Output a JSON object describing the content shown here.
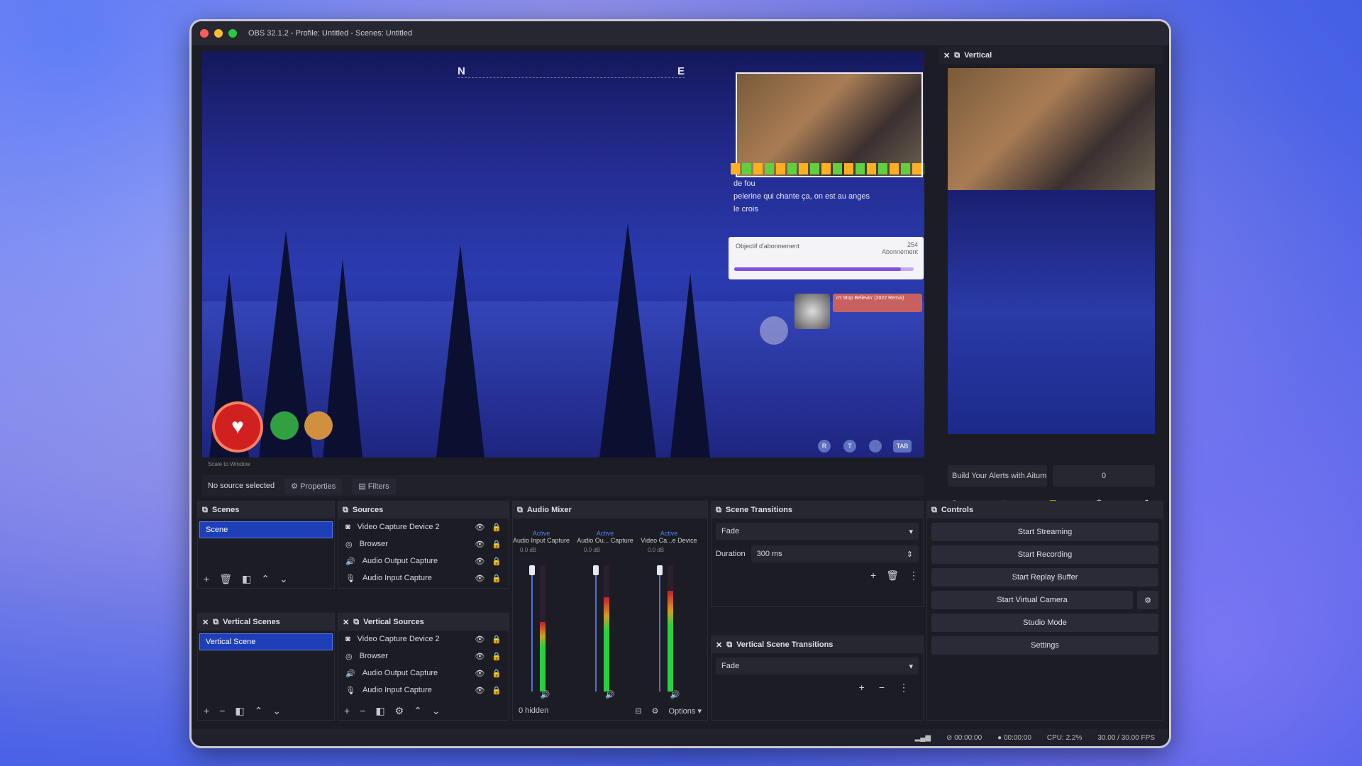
{
  "window": {
    "title": "OBS 32.1.2 - Profile: Untitled - Scenes: Untitled"
  },
  "preview": {
    "compass": [
      "N",
      "E"
    ],
    "chat": [
      {
        "name": "",
        "text": "de fou"
      },
      {
        "name": "",
        "text": "pelerine qui chante ça, on est au anges"
      },
      {
        "name": "",
        "text": "le crois"
      }
    ],
    "goal": {
      "label": "Objectif d'abonnement",
      "count": "254",
      "sub": "Abonnement",
      "progress": 0.93
    },
    "music": {
      "title": "n't Stop Believin' (2022 Remix)"
    },
    "keys": [
      "R",
      "T",
      "",
      "TAB"
    ],
    "zoom_strip": "Scale to Window"
  },
  "source_bar": {
    "no_source": "No source selected",
    "properties": "Properties",
    "filters": "Filters"
  },
  "vertical": {
    "title": "Vertical",
    "alert_button": "Build Your Alerts with Aitum",
    "count": "0"
  },
  "scenes": {
    "title": "Scenes",
    "items": [
      "Scene"
    ]
  },
  "sources": {
    "title": "Sources",
    "items": [
      "Video Capture Device 2",
      "Browser",
      "Audio Output Capture",
      "Audio Input Capture"
    ]
  },
  "vertical_scenes": {
    "title": "Vertical Scenes",
    "items": [
      "Vertical Scene"
    ]
  },
  "vertical_sources": {
    "title": "Vertical Sources",
    "items": [
      "Video Capture Device 2",
      "Browser",
      "Audio Output Capture",
      "Audio Input Capture"
    ]
  },
  "mixer": {
    "title": "Audio Mixer",
    "channels": [
      {
        "label": "Audio Input Capture",
        "status": "Active",
        "db": "0.0 dB",
        "level": 0.55
      },
      {
        "label": "Audio Ou... Capture",
        "status": "Active",
        "db": "0.0 dB",
        "level": 0.75
      },
      {
        "label": "Video Ca...e Device",
        "status": "Active",
        "db": "0.0 dB",
        "level": 0.8
      }
    ],
    "hidden": "0 hidden",
    "options": "Options"
  },
  "transitions": {
    "title": "Scene Transitions",
    "selected": "Fade",
    "duration_label": "Duration",
    "duration": "300 ms"
  },
  "vertical_transitions": {
    "title": "Vertical Scene Transitions",
    "selected": "Fade"
  },
  "controls": {
    "title": "Controls",
    "buttons": [
      "Start Streaming",
      "Start Recording",
      "Start Replay Buffer",
      "Start Virtual Camera",
      "Studio Mode",
      "Settings"
    ]
  },
  "status": {
    "stream_time": "00:00:00",
    "rec_time": "00:00:00",
    "cpu": "CPU: 2.2%",
    "fps": "30.00 / 30.00 FPS"
  },
  "colors": {
    "accent": "#1e3fb8",
    "window_bg": "#1c1d24",
    "close": "#ff5f57",
    "minimize": "#febc2e",
    "maximize": "#28c840"
  }
}
